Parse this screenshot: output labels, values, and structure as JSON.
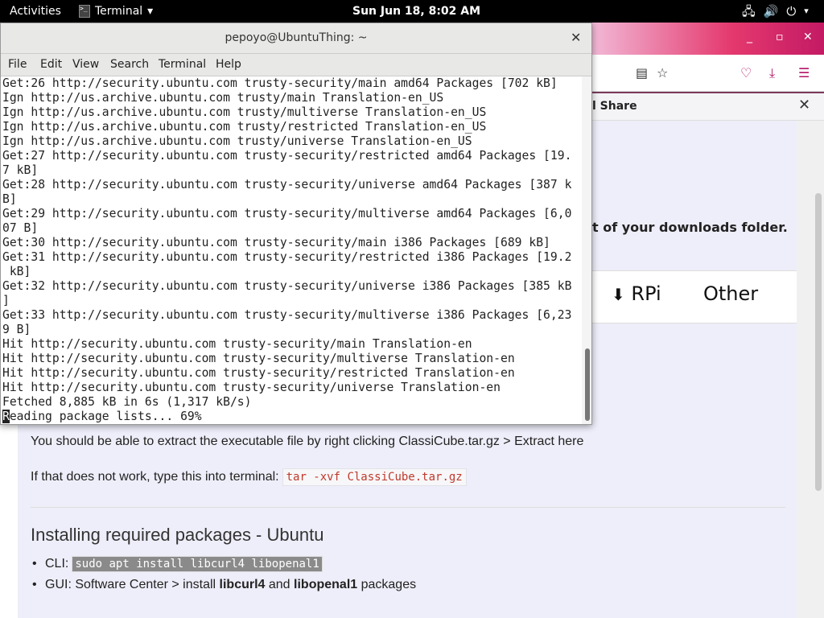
{
  "topbar": {
    "activities": "Activities",
    "app": "Terminal",
    "clock": "Sun Jun 18,  8:02 AM"
  },
  "browser": {
    "share_label": "l Share",
    "download_note": "t of your downloads folder.",
    "tabs": {
      "rpi": "RPi",
      "other": "Other"
    }
  },
  "page": {
    "extract_text": "You should be able to extract the executable file by right clicking ClassiCube.tar.gz > Extract here",
    "fallback_text": "If that does not work, type this into terminal:",
    "fallback_code": "tar -xvf ClassiCube.tar.gz",
    "heading": "Installing required packages - Ubuntu",
    "cli_label": "CLI:",
    "cli_code": "sudo apt install libcurl4 libopenal1",
    "gui_prefix": "GUI: Software Center > install ",
    "gui_pkg1": "libcurl4",
    "gui_and": " and ",
    "gui_pkg2": "libopenal1",
    "gui_suffix": " packages"
  },
  "terminal": {
    "title": "pepoyo@UbuntuThing: ~",
    "menu": [
      "File",
      "Edit",
      "View",
      "Search",
      "Terminal",
      "Help"
    ],
    "lines": [
      "Get:26 http://security.ubuntu.com trusty-security/main amd64 Packages [702 kB]",
      "Ign http://us.archive.ubuntu.com trusty/main Translation-en_US",
      "Ign http://us.archive.ubuntu.com trusty/multiverse Translation-en_US",
      "Ign http://us.archive.ubuntu.com trusty/restricted Translation-en_US",
      "Ign http://us.archive.ubuntu.com trusty/universe Translation-en_US",
      "Get:27 http://security.ubuntu.com trusty-security/restricted amd64 Packages [19.",
      "7 kB]",
      "Get:28 http://security.ubuntu.com trusty-security/universe amd64 Packages [387 k",
      "B]",
      "Get:29 http://security.ubuntu.com trusty-security/multiverse amd64 Packages [6,0",
      "07 B]",
      "Get:30 http://security.ubuntu.com trusty-security/main i386 Packages [689 kB]",
      "Get:31 http://security.ubuntu.com trusty-security/restricted i386 Packages [19.2",
      " kB]",
      "Get:32 http://security.ubuntu.com trusty-security/universe i386 Packages [385 kB",
      "]",
      "Get:33 http://security.ubuntu.com trusty-security/multiverse i386 Packages [6,23",
      "9 B]",
      "Hit http://security.ubuntu.com trusty-security/main Translation-en",
      "Hit http://security.ubuntu.com trusty-security/multiverse Translation-en",
      "Hit http://security.ubuntu.com trusty-security/restricted Translation-en",
      "Hit http://security.ubuntu.com trusty-security/universe Translation-en",
      "Fetched 8,885 kB in 6s (1,317 kB/s)"
    ],
    "last_line_cursor": "R",
    "last_line_rest": "eading package lists... 69%"
  }
}
